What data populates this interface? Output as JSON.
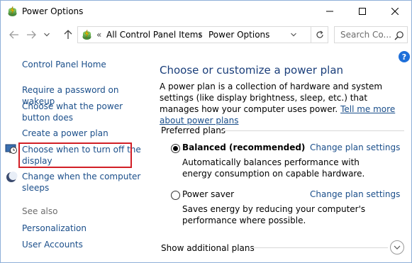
{
  "window": {
    "title": "Power Options",
    "controls": {
      "minimize_icon": "minimize-icon",
      "maximize_icon": "maximize-icon",
      "close_icon": "close-icon"
    }
  },
  "nav": {
    "back_icon": "arrow-left-icon",
    "forward_icon": "arrow-right-icon",
    "recent_icon": "chevron-down-icon",
    "up_icon": "arrow-up-icon",
    "address": {
      "separator": "«",
      "crumbs": [
        "All Control Panel Items",
        "Power Options"
      ],
      "crumb_separator": "›"
    },
    "search_placeholder": "Search Co..."
  },
  "help": {
    "label": "?"
  },
  "sidebar": {
    "home": "Control Panel Home",
    "links": [
      "Require a password on wakeup",
      "Choose what the power button does",
      "Create a power plan",
      "Choose when to turn off the display",
      "Change when the computer sleeps"
    ],
    "see_also": {
      "label": "See also",
      "links": [
        "Personalization",
        "User Accounts"
      ]
    }
  },
  "main": {
    "title": "Choose or customize a power plan",
    "description": "A power plan is a collection of hardware and system settings (like display brightness, sleep, etc.) that manages how your computer uses power.",
    "learn_more": "Tell me more about power plans",
    "group_label": "Preferred plans",
    "plans": [
      {
        "name": "Balanced (recommended)",
        "selected": true,
        "change_label": "Change plan settings",
        "description": "Automatically balances performance with energy consumption on capable hardware."
      },
      {
        "name": "Power saver",
        "selected": false,
        "change_label": "Change plan settings",
        "description": "Saves energy by reducing your computer's performance where possible."
      }
    ],
    "show_more": "Show additional plans"
  },
  "colors": {
    "link": "#1a4e8a",
    "title": "#1a3e7a",
    "highlight": "#d21f26",
    "help": "#1e6fd9"
  }
}
